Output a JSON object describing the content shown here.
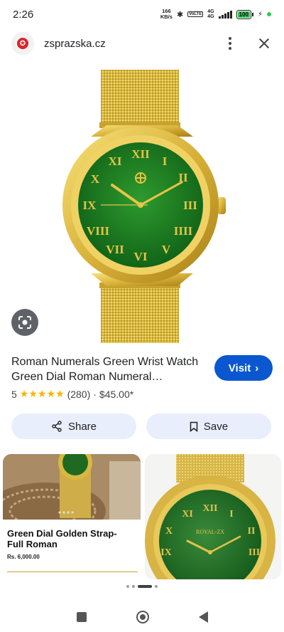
{
  "status_bar": {
    "time": "2:26",
    "speed_value": "166",
    "speed_unit": "KB/s",
    "network_type": "4G",
    "network_sub": "4G",
    "volte_label": "VoLTE",
    "battery": "100"
  },
  "header": {
    "domain": "zsprazska.cz"
  },
  "product": {
    "title": "Roman Numerals Green Wrist Watch Green Dial Roman Numeral…",
    "rating_value": "5",
    "stars": "★★★★★",
    "review_count": "(280)",
    "separator": "·",
    "price": "$45.00*",
    "visit_label": "Visit",
    "visit_chevron": "›"
  },
  "actions": {
    "share_label": "Share",
    "save_label": "Save"
  },
  "related": [
    {
      "title": "Green Dial Golden Strap- Full Roman",
      "price": "Rs. 6,000.00"
    },
    {
      "brand_on_dial": "ROYAL-ZX"
    }
  ],
  "watch_numerals": [
    "XII",
    "I",
    "II",
    "III",
    "IIII",
    "V",
    "VI",
    "VII",
    "VIII",
    "IX",
    "X",
    "XI"
  ],
  "colors": {
    "accent": "#0b57d0",
    "action_bg": "#e8eefb",
    "star": "#f6b400",
    "dial_green": "#1f7a1f",
    "gold": "#d8b640"
  }
}
